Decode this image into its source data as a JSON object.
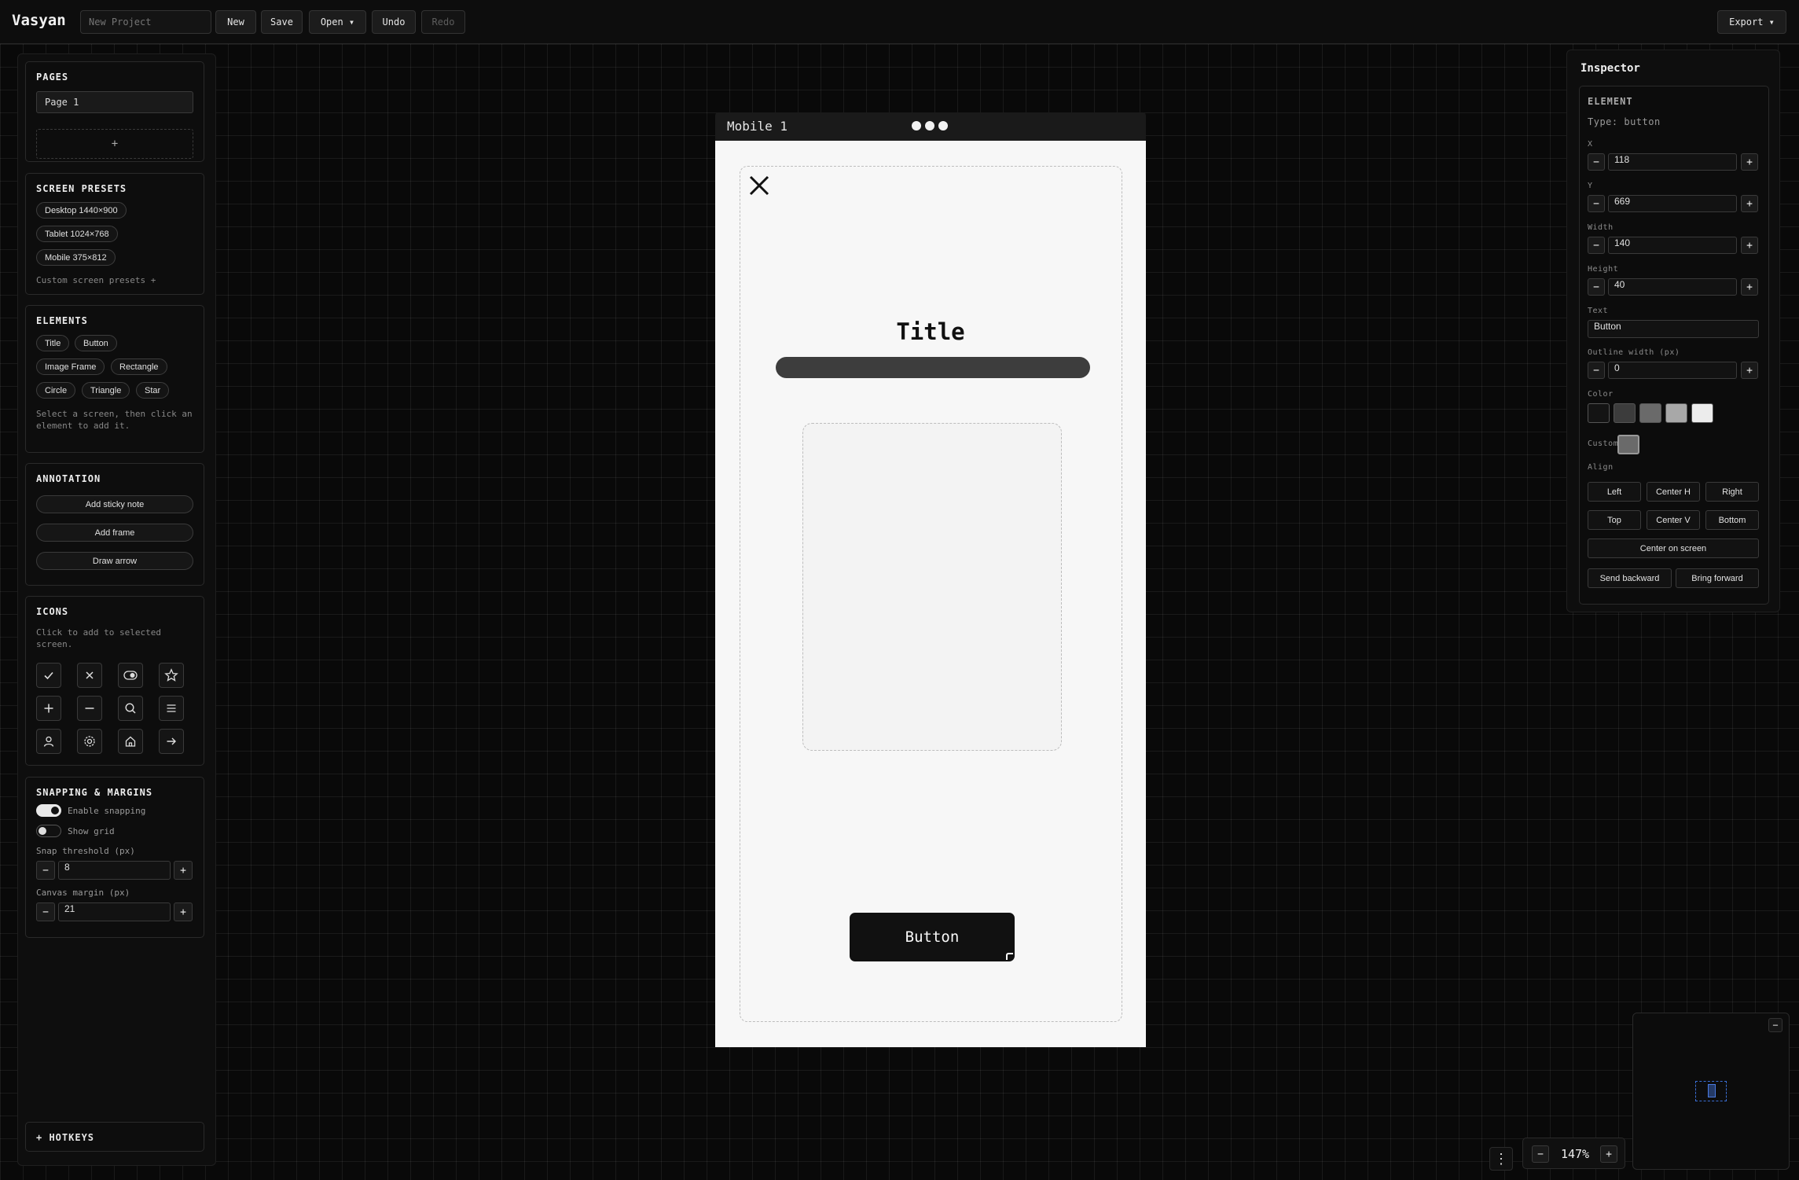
{
  "app": {
    "brand": "Vasyan"
  },
  "toolbar": {
    "project_placeholder": "New Project",
    "new": "New",
    "save": "Save",
    "open": "Open ▾",
    "undo": "Undo",
    "redo": "Redo",
    "export": "Export ▾"
  },
  "pages": {
    "title": "PAGES",
    "items": [
      "Page 1"
    ],
    "add_label": "+"
  },
  "screen_presets": {
    "title": "SCREEN PRESETS",
    "items": [
      "Desktop 1440×900",
      "Tablet 1024×768",
      "Mobile 375×812"
    ],
    "custom_label": "Custom screen presets +"
  },
  "elements": {
    "title": "ELEMENTS",
    "items": [
      "Title",
      "Button",
      "Image Frame",
      "Rectangle",
      "Circle",
      "Triangle",
      "Star"
    ],
    "hint": "Select a screen, then click an element to add it."
  },
  "annotation": {
    "title": "ANNOTATION",
    "items": [
      "Add sticky note",
      "Add frame",
      "Draw arrow"
    ]
  },
  "icons": {
    "title": "ICONS",
    "hint": "Click to add to selected screen.",
    "items": [
      "check-icon",
      "close-icon",
      "toggle-icon",
      "star-icon",
      "plus-icon",
      "minus-icon",
      "search-icon",
      "menu-icon",
      "user-icon",
      "gear-icon",
      "home-icon",
      "arrow-right-icon"
    ]
  },
  "snapping": {
    "title": "SNAPPING & MARGINS",
    "enable_label": "Enable snapping",
    "enable_on": true,
    "grid_label": "Show grid",
    "grid_on": false,
    "threshold_label": "Snap threshold (px)",
    "threshold_value": "8",
    "margin_label": "Canvas margin (px)",
    "margin_value": "21",
    "minus": "−",
    "plus": "+"
  },
  "hotkeys": {
    "label": "+ HOTKEYS"
  },
  "screen": {
    "name": "Mobile 1",
    "title_text": "Title",
    "button_text": "Button"
  },
  "inspector": {
    "title": "Inspector",
    "section": "ELEMENT",
    "type_label": "Type: button",
    "x_label": "X",
    "x_value": "118",
    "y_label": "Y",
    "y_value": "669",
    "width_label": "Width",
    "width_value": "140",
    "height_label": "Height",
    "height_value": "40",
    "text_label": "Text",
    "text_value": "Button",
    "outline_label": "Outline width (px)",
    "outline_value": "0",
    "color_label": "Color",
    "colors": [
      "#141414",
      "#3c3c3c",
      "#6a6a6a",
      "#a8a8a8",
      "#ececec"
    ],
    "custom_label": "Custom",
    "custom_color": "#6a6a6a",
    "align_label": "Align",
    "align_buttons": [
      "Left",
      "Center H",
      "Right",
      "Top",
      "Center V",
      "Bottom"
    ],
    "center_label": "Center on screen",
    "send_backward": "Send backward",
    "bring_forward": "Bring forward",
    "minus": "−",
    "plus": "+"
  },
  "minimap": {
    "close": "−"
  },
  "zoom": {
    "minus": "−",
    "value": "147%",
    "plus": "+",
    "more": "⋮"
  }
}
